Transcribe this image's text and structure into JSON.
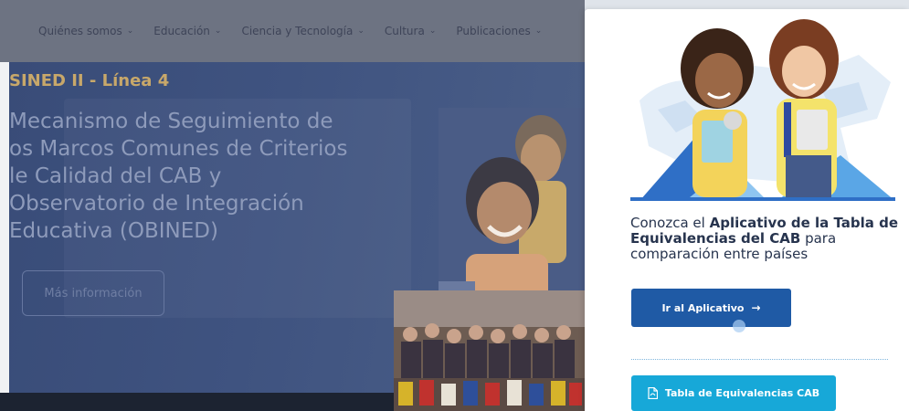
{
  "nav": {
    "items": [
      {
        "label": "Quiénes somos"
      },
      {
        "label": "Educación"
      },
      {
        "label": "Ciencia y Tecnología"
      },
      {
        "label": "Cultura"
      },
      {
        "label": "Publicaciones"
      }
    ],
    "chevron": "chevron-down-icon"
  },
  "hero": {
    "subtitle": "SINED II - Línea 4",
    "title_lines": [
      "Mecanismo de Seguimiento de",
      "os Marcos Comunes de Criterios",
      "le Calidad del CAB y",
      "Observatorio de Integración",
      "Educativa (OBINED)"
    ],
    "button_label": "Más información"
  },
  "panel": {
    "text_prefix": "Conozca el ",
    "text_bold": "Aplicativo de la Tabla de Equivalencias del CAB",
    "text_suffix": " para comparación entre países",
    "primary_button": "Ir al Aplicativo",
    "arrow_icon": "arrow-right-icon",
    "secondary_button": "Tabla de Equivalencias CAB",
    "pdf_icon": "pdf-icon"
  },
  "colors": {
    "hero_bg": "#3f5380",
    "primary_button": "#1f5aa5",
    "secondary_button": "#17a8d8",
    "panel_text": "#27344e"
  }
}
